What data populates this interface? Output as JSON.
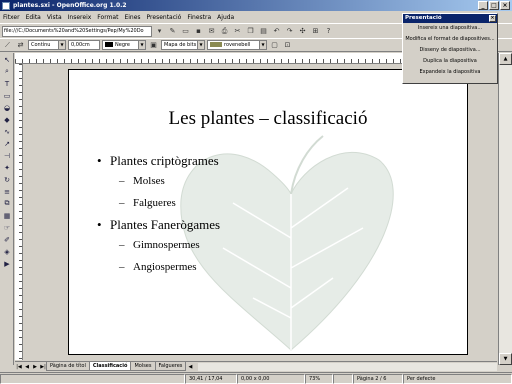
{
  "window": {
    "title": "plantes.sxi - OpenOffice.org 1.0.2",
    "min_label": "_",
    "max_label": "□",
    "close_label": "×"
  },
  "menu": [
    "Fitxer",
    "Edita",
    "Vista",
    "Insereix",
    "Format",
    "Eines",
    "Presentació",
    "Finestra",
    "Ajuda"
  ],
  "toolbar": {
    "url": "file:///C:/Documents%20and%20Settings/Pep/My%20Do"
  },
  "formatbar": {
    "line_style": "Contínu",
    "line_width": "0,00cm",
    "line_color": "Negre",
    "fill_type": "Mapa de bits",
    "fill_name": "rovenebell"
  },
  "slide": {
    "title": "Les plantes – classificació",
    "items": [
      {
        "text": "Plantes criptògrames",
        "level": 1
      },
      {
        "text": "Molses",
        "level": 2
      },
      {
        "text": "Falgueres",
        "level": 2
      },
      {
        "text": "Plantes Fanerògames",
        "level": 1
      },
      {
        "text": "Gimnospermes",
        "level": 2
      },
      {
        "text": "Angiospermes",
        "level": 2
      }
    ]
  },
  "tabs": [
    "Pàgina de títol",
    "Classificació",
    "Molses",
    "Falgueres"
  ],
  "active_tab": 1,
  "status": {
    "position": "30,41 / 17,04",
    "size": "0,00 x 0,00",
    "zoom": "73%",
    "page": "Pàgina 2 / 6",
    "layout": "Per defecte"
  },
  "panel": {
    "title": "Presentació",
    "items": [
      "Insereix una diapositiva...",
      "Modifica el format de diapositives...",
      "Disseny de diapositiva...",
      "Duplica la diapositiva",
      "Expandeix la diapositiva"
    ]
  },
  "colors": {
    "titlebar": "#0a246a",
    "leaf": "#e6ece7"
  }
}
